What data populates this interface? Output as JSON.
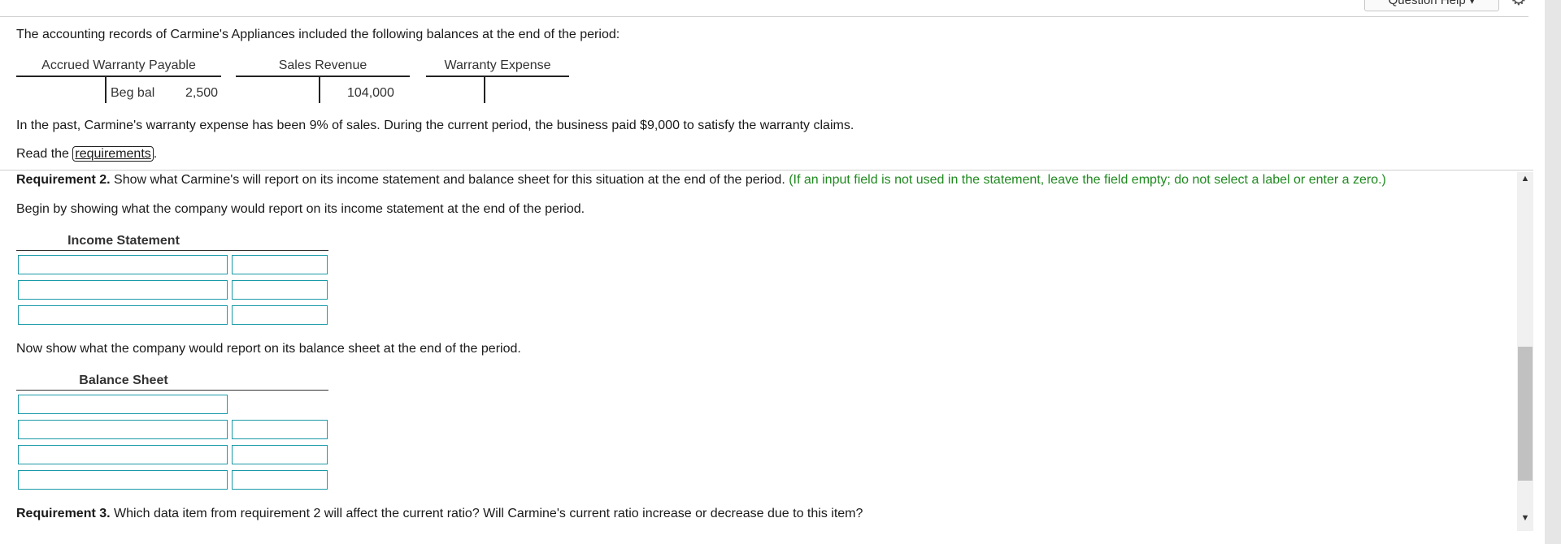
{
  "header": {
    "question_help": "Question Help ▾"
  },
  "intro": {
    "line": "The accounting records of Carmine's Appliances included the following balances at the end of the period:"
  },
  "t_accounts": [
    {
      "title": "Accrued Warranty Payable",
      "right_label": "Beg bal",
      "right_value": "2,500"
    },
    {
      "title": "Sales Revenue",
      "right_value": "104,000"
    },
    {
      "title": "Warranty Expense"
    }
  ],
  "facts": {
    "line": "In the past, Carmine's warranty expense has been 9% of sales. During the current period, the business paid $9,000 to satisfy the warranty claims."
  },
  "read": {
    "prefix": "Read the ",
    "link": "requirements",
    "suffix": "."
  },
  "req2": {
    "label": "Requirement 2.",
    "text": " Show what Carmine's will report on its income statement and balance sheet for this situation at the end of the period. ",
    "hint": "(If an input field is not used in the statement, leave the field empty; do not select a label or enter a zero.)"
  },
  "income": {
    "intro": "Begin by showing what the company would report on its income statement at the end of the period.",
    "title": "Income Statement"
  },
  "balance": {
    "intro": "Now show what the company would report on its balance sheet at the end of the period.",
    "title": "Balance Sheet"
  },
  "req3": {
    "label": "Requirement 3.",
    "text": " Which data item from requirement 2 will affect the current ratio? Will Carmine's current ratio increase or decrease due to  this item?"
  }
}
